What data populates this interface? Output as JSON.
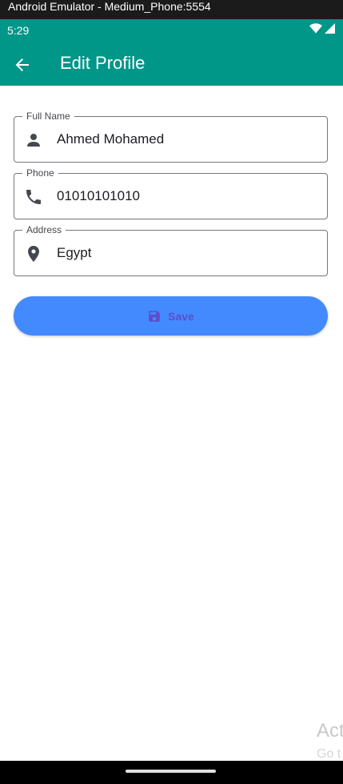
{
  "window": {
    "title": "Android Emulator - Medium_Phone:5554"
  },
  "status_bar": {
    "time": "5:29",
    "icons": [
      "wifi-icon",
      "cellular-signal-icon"
    ]
  },
  "app_bar": {
    "title": "Edit Profile",
    "back_icon": "arrow-back-icon"
  },
  "form": {
    "fields": [
      {
        "label": "Full Name",
        "value": "Ahmed Mohamed",
        "icon": "person-icon"
      },
      {
        "label": "Phone",
        "value": "01010101010",
        "icon": "phone-icon"
      },
      {
        "label": "Address",
        "value": "Egypt",
        "icon": "location-pin-icon"
      }
    ],
    "save_button": {
      "label": "Save",
      "icon": "save-icon"
    }
  },
  "overlay": {
    "line1": "Act",
    "line2": "Go t"
  },
  "colors": {
    "primary": "#009688",
    "button": "#448aff",
    "button_text": "#5b4fc9",
    "outline": "#79747e"
  }
}
